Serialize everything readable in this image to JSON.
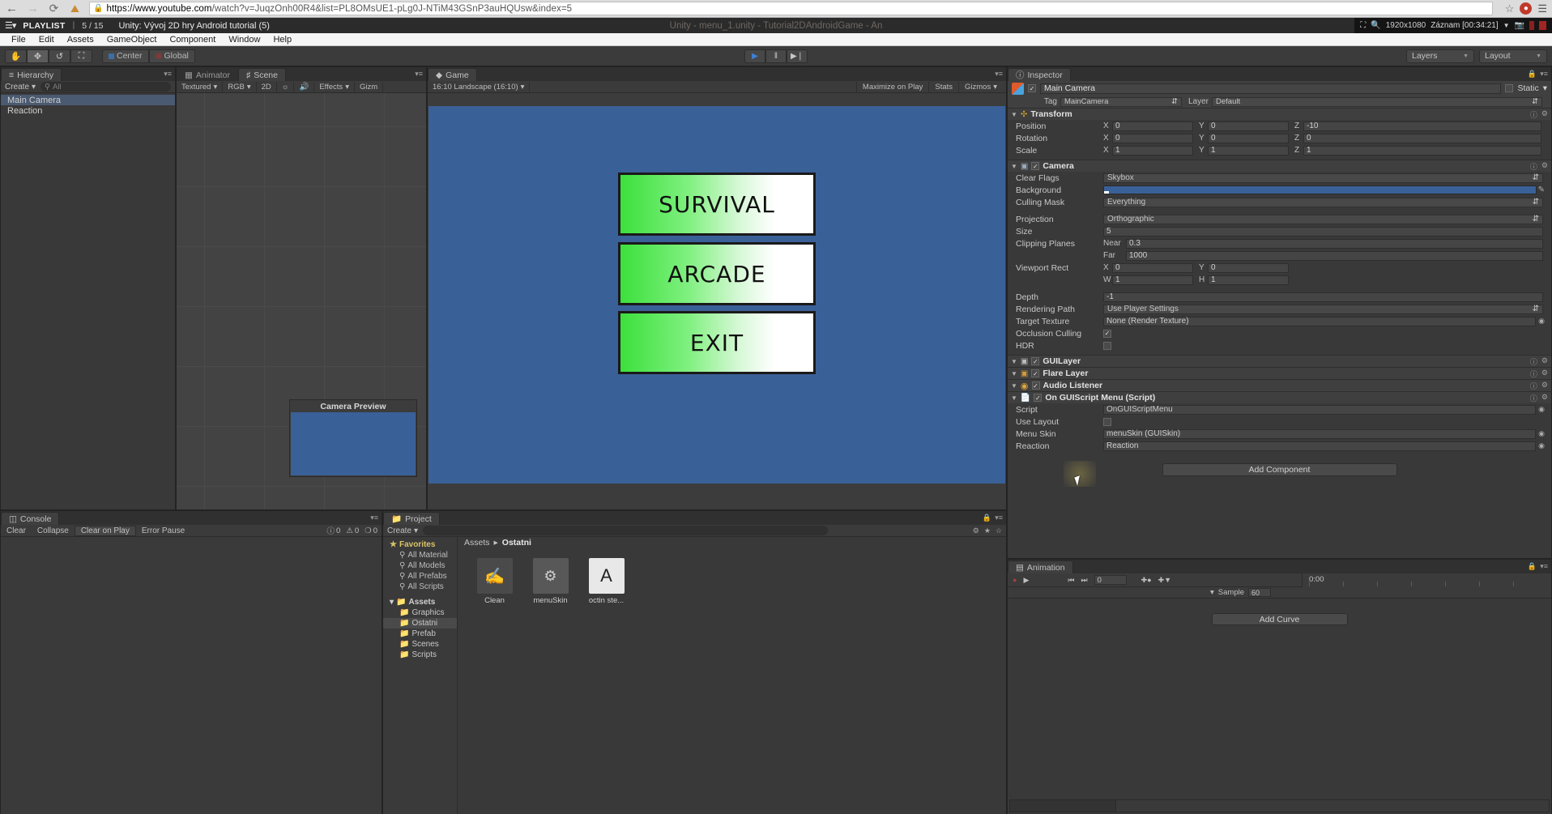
{
  "browser": {
    "url_domain": "https://www.youtube.com",
    "url_path": "/watch?v=JuqzOnh00R4&list=PL8OMsUE1-pLg0J-NTiM43GSnP3auHQUsw&index=5",
    "back_icon": "back-arrow-icon",
    "forward_icon": "forward-arrow-icon",
    "reload_icon": "reload-icon",
    "home_icon": "home-icon",
    "lock_icon": "lock-icon",
    "star_icon": "bookmark-star-icon",
    "menu_icon": "browser-menu-icon",
    "notification_count": ""
  },
  "youtube": {
    "playlist_icon": "playlist-icon",
    "playlist_label": "PLAYLIST",
    "separator": "|",
    "index_label": "5 / 15",
    "video_title": "Unity: Vývoj 2D hry Android tutorial (5)"
  },
  "unity_window": {
    "title": "Unity - menu_1.unity - Tutorial2DAndroidGame - An"
  },
  "recorder": {
    "window_icon": "window-select-icon",
    "zoom_icon": "magnifier-icon",
    "resolution": "1920x1080",
    "record_label": "Záznam [00:34:21]",
    "caret_icon": "chevron-down-icon",
    "camera_icon": "camera-icon",
    "pause_icon": "pause-icon",
    "stop_icon": "stop-icon"
  },
  "menubar": [
    "File",
    "Edit",
    "Assets",
    "GameObject",
    "Component",
    "Window",
    "Help"
  ],
  "toolbar": {
    "tools": [
      {
        "name": "hand-tool",
        "glyph": "✋",
        "active": false
      },
      {
        "name": "move-tool",
        "glyph": "✥",
        "active": true
      },
      {
        "name": "rotate-tool",
        "glyph": "↺",
        "active": false
      },
      {
        "name": "scale-tool",
        "glyph": "⛶",
        "active": false
      }
    ],
    "pivot_label": "Center",
    "space_label": "Global",
    "play_glyph": "▶",
    "pause_glyph": "‖",
    "step_glyph": "▶❘",
    "layers_label": "Layers",
    "layout_label": "Layout"
  },
  "hierarchy": {
    "tab_label": "Hierarchy",
    "tab_icon": "hierarchy-icon",
    "create_label": "Create",
    "search_placeholder": "All",
    "search_icon": "search-icon",
    "items": [
      {
        "label": "Main Camera",
        "selected": true
      },
      {
        "label": "Reaction",
        "selected": false
      }
    ]
  },
  "scene_panel": {
    "tabs": [
      {
        "label": "Animator",
        "icon": "animator-icon",
        "active": false
      },
      {
        "label": "Scene",
        "icon": "scene-grid-icon",
        "active": true
      }
    ],
    "toolbar": {
      "draw_mode": "Textured",
      "color_mode": "RGB",
      "mode_2d": "2D",
      "light_icon": "sun-icon",
      "audio_icon": "speaker-icon",
      "effects": "Effects",
      "gizmos": "Gizm"
    },
    "camera_preview_title": "Camera Preview"
  },
  "game_panel": {
    "tab_label": "Game",
    "tab_icon": "game-icon",
    "aspect": "16:10 Landscape (16:10)",
    "maximize_on_play": "Maximize on Play",
    "stats": "Stats",
    "gizmos": "Gizmos",
    "buttons": [
      {
        "label": "SURVIVAL"
      },
      {
        "label": "ARCADE"
      },
      {
        "label": "EXIT"
      }
    ],
    "background_color": "#3a6098"
  },
  "console": {
    "tab_label": "Console",
    "tab_icon": "console-icon",
    "clear_label": "Clear",
    "collapse_label": "Collapse",
    "clear_on_play_label": "Clear on Play",
    "error_pause_label": "Error Pause",
    "counts": [
      {
        "icon": "info-icon",
        "value": "0"
      },
      {
        "icon": "warning-icon",
        "value": "0"
      },
      {
        "icon": "error-icon",
        "value": "0"
      }
    ]
  },
  "project": {
    "tab_label": "Project",
    "tab_icon": "project-icon",
    "create_label": "Create",
    "search_placeholder": "",
    "breadcrumb": [
      "Assets",
      "Ostatni"
    ],
    "tree": [
      {
        "label": "Favorites",
        "type": "fav"
      },
      {
        "label": "All Material",
        "type": "search"
      },
      {
        "label": "All Models",
        "type": "search"
      },
      {
        "label": "All Prefabs",
        "type": "search"
      },
      {
        "label": "All Scripts",
        "type": "search"
      },
      {
        "label": "Assets",
        "type": "root"
      },
      {
        "label": "Graphics",
        "type": "folder"
      },
      {
        "label": "Ostatni",
        "type": "folder",
        "selected": true
      },
      {
        "label": "Prefab",
        "type": "folder"
      },
      {
        "label": "Scenes",
        "type": "folder"
      },
      {
        "label": "Scripts",
        "type": "folder"
      }
    ],
    "assets": [
      {
        "label": "Clean",
        "icon": "brush-icon"
      },
      {
        "label": "menuSkin",
        "icon": "guiskin-icon"
      },
      {
        "label": "octin ste...",
        "icon": "font-icon"
      }
    ]
  },
  "inspector": {
    "tab_label": "Inspector",
    "tab_icon": "info-icon",
    "lock_icon": "lock-icon",
    "options_icon": "options-icon",
    "gameobject": {
      "name": "Main Camera",
      "enabled": true,
      "static_label": "Static",
      "tag_label": "Tag",
      "tag_value": "MainCamera",
      "layer_label": "Layer",
      "layer_value": "Default"
    },
    "components": [
      {
        "name": "Transform",
        "icon": "transform-icon",
        "rows": [
          {
            "label": "Position",
            "fields": [
              [
                "X",
                "0"
              ],
              [
                "Y",
                "0"
              ],
              [
                "Z",
                "-10"
              ]
            ]
          },
          {
            "label": "Rotation",
            "fields": [
              [
                "X",
                "0"
              ],
              [
                "Y",
                "0"
              ],
              [
                "Z",
                "0"
              ]
            ]
          },
          {
            "label": "Scale",
            "fields": [
              [
                "X",
                "1"
              ],
              [
                "Y",
                "1"
              ],
              [
                "Z",
                "1"
              ]
            ]
          }
        ]
      },
      {
        "name": "Camera",
        "icon": "camera-icon",
        "enabled": true,
        "rows": [
          {
            "label": "Clear Flags",
            "type": "select",
            "value": "Skybox"
          },
          {
            "label": "Background",
            "type": "color",
            "value": "#3a6098"
          },
          {
            "label": "Culling Mask",
            "type": "select",
            "value": "Everything"
          },
          {
            "label": "Projection",
            "type": "select",
            "value": "Orthographic"
          },
          {
            "label": "Size",
            "type": "text",
            "value": "5"
          },
          {
            "label": "Clipping Planes",
            "type": "pair",
            "fields": [
              [
                "Near",
                "0.3"
              ]
            ]
          },
          {
            "label": "",
            "type": "pair",
            "fields": [
              [
                "Far",
                "1000"
              ]
            ]
          },
          {
            "label": "Viewport Rect",
            "type": "xy",
            "fields": [
              [
                "X",
                "0"
              ],
              [
                "Y",
                "0"
              ]
            ]
          },
          {
            "label": "",
            "type": "xy",
            "fields": [
              [
                "W",
                "1"
              ],
              [
                "H",
                "1"
              ]
            ]
          },
          {
            "label": "Depth",
            "type": "text",
            "value": "-1"
          },
          {
            "label": "Rendering Path",
            "type": "select",
            "value": "Use Player Settings"
          },
          {
            "label": "Target Texture",
            "type": "object",
            "value": "None (Render Texture)"
          },
          {
            "label": "Occlusion Culling",
            "type": "check",
            "value": true
          },
          {
            "label": "HDR",
            "type": "check",
            "value": false
          }
        ]
      },
      {
        "name": "GUILayer",
        "icon": "guilayer-icon",
        "enabled": true,
        "collapsed": true
      },
      {
        "name": "Flare Layer",
        "icon": "flare-icon",
        "enabled": true,
        "collapsed": true
      },
      {
        "name": "Audio Listener",
        "icon": "audio-icon",
        "enabled": true,
        "collapsed": true
      },
      {
        "name": "On GUIScript Menu (Script)",
        "icon": "script-icon",
        "enabled": true,
        "rows": [
          {
            "label": "Script",
            "type": "object",
            "value": "OnGUIScriptMenu"
          },
          {
            "label": "Use Layout",
            "type": "check",
            "value": false
          },
          {
            "label": "Menu Skin",
            "type": "object",
            "value": "menuSkin (GUISkin)"
          },
          {
            "label": "Reaction",
            "type": "object",
            "value": "Reaction"
          }
        ]
      }
    ],
    "add_component_label": "Add Component"
  },
  "animation": {
    "tab_label": "Animation",
    "tab_icon": "animation-icon",
    "record_icon": "record-icon",
    "play_icon": "play-icon",
    "prev_key_icon": "prev-keyframe-icon",
    "next_key_icon": "next-keyframe-icon",
    "frame_value": "0",
    "add_key_icon": "add-keyframe-icon",
    "add_event_icon": "add-event-icon",
    "time_label": "0:00",
    "sample_label": "Sample",
    "sample_value": "60",
    "add_curve_label": "Add Curve"
  }
}
